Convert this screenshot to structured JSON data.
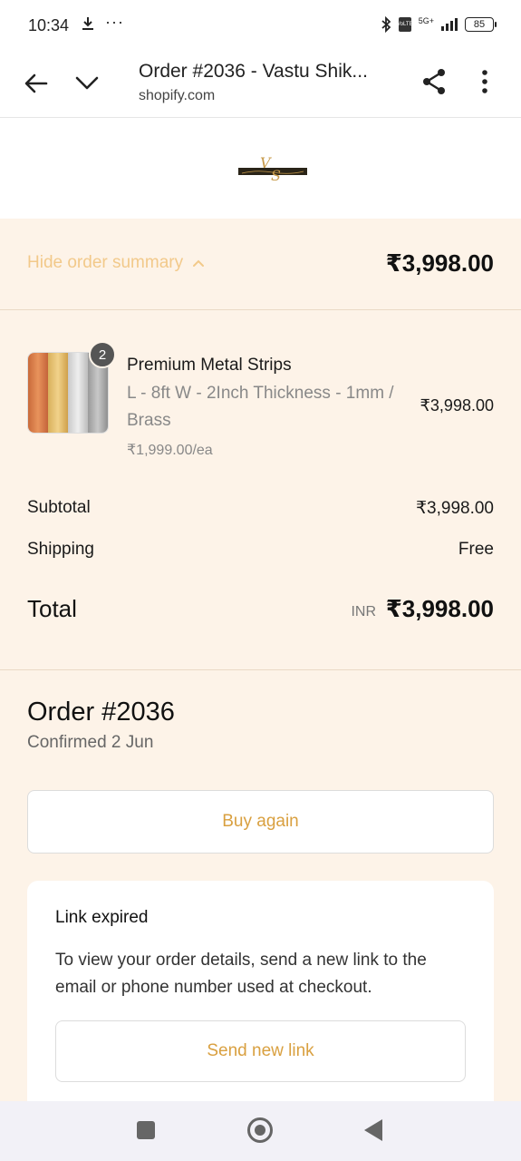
{
  "status_bar": {
    "time": "10:34",
    "dots": "···",
    "network": "5G+",
    "battery": "85"
  },
  "browser": {
    "title": "Order #2036 - Vastu Shik...",
    "domain": "shopify.com"
  },
  "summary": {
    "toggle_label": "Hide order summary",
    "toggle_total": "₹3,998.00",
    "product": {
      "name": "Premium Metal Strips",
      "variant": "L - 8ft W - 2Inch Thickness - 1mm / Brass",
      "unit_price": "₹1,999.00/ea",
      "price": "₹3,998.00",
      "quantity": "2"
    },
    "subtotal_label": "Subtotal",
    "subtotal_value": "₹3,998.00",
    "shipping_label": "Shipping",
    "shipping_value": "Free",
    "total_label": "Total",
    "total_currency": "INR",
    "total_value": "₹3,998.00"
  },
  "order": {
    "title": "Order #2036",
    "confirmed": "Confirmed 2 Jun",
    "buy_again": "Buy again"
  },
  "link_card": {
    "title": "Link expired",
    "text": "To view your order details, send a new link to the email or phone number used at checkout.",
    "button": "Send new link"
  },
  "colors": {
    "accent": "#d9a040",
    "summary_bg": "#fdf3e8",
    "toggle_text": "#f2c98a"
  }
}
